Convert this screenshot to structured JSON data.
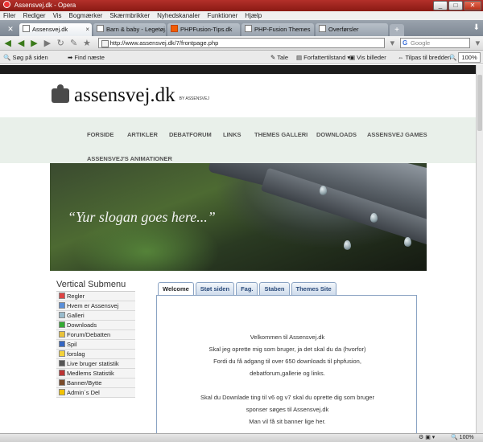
{
  "window": {
    "title": "Assensvej.dk - Opera",
    "controls": [
      "_",
      "□",
      "✕"
    ]
  },
  "menu": [
    "Filer",
    "Rediger",
    "Vis",
    "Bogmærker",
    "Skærmbrikker",
    "Nyhedskanaler",
    "Funktioner",
    "Hjælp"
  ],
  "tabs": [
    {
      "label": "Assensvej.dk",
      "active": true
    },
    {
      "label": "Barn & baby - Legetøj..."
    },
    {
      "label": "PHPFusion-Tips.dk"
    },
    {
      "label": "PHP-Fusion Themes"
    },
    {
      "label": "Overførsler"
    }
  ],
  "nav": {
    "address": "http://www.assensvej.dk/7/frontpage.php",
    "search_placeholder": "Google"
  },
  "toolbar": {
    "find_placeholder": "Søg på siden",
    "find_next": "Find næste",
    "speak": "Tale",
    "author_mode": "Forfattertilstand",
    "show_images": "Vis billeder",
    "fit_width": "Tilpas til bredden",
    "zoom": "100%"
  },
  "site": {
    "logo": "assensvej.dk",
    "logo_by": "BY ASSENSVEJ",
    "nav": [
      "FORSIDE",
      "ARTIKLER",
      "DEBATFORUM",
      "LINKS",
      "THEMES GALLERI",
      "DOWNLOADS",
      "ASSENSVEJ GAMES",
      "ASSENSVEJ'S ANIMATIONER"
    ],
    "slogan": "“Yur slogan goes here...”",
    "submenu_title": "Vertical Submenu",
    "submenu": [
      "Regler",
      "Hvem er Assensvej",
      "Galleri",
      "Downloads",
      "Forum/Debatten",
      "Spil",
      "forslag",
      "Live bruger statistik",
      "Medlems Statistik",
      "Banner/Bytte",
      "Admin´s Del"
    ],
    "content_tabs": [
      "Welcome",
      "Støt siden",
      "Fag.",
      "Staben",
      "Themes Site"
    ],
    "welcome": [
      "Velkommen til Assensvej.dk",
      "Skal jeg oprette mig som bruger, ja det skal du da (hvorfor)",
      "Fordi du få adgang til over 650 downloads til phpfusion,",
      "debatforum,gallerie og links.",
      "",
      "Skal du Downlade ting til v6 og v7 skal du oprette dig som bruger",
      "sponser søges til Assensvej.dk",
      "Man vil få sit banner lige her."
    ]
  },
  "status": {
    "zoom": "100%"
  }
}
